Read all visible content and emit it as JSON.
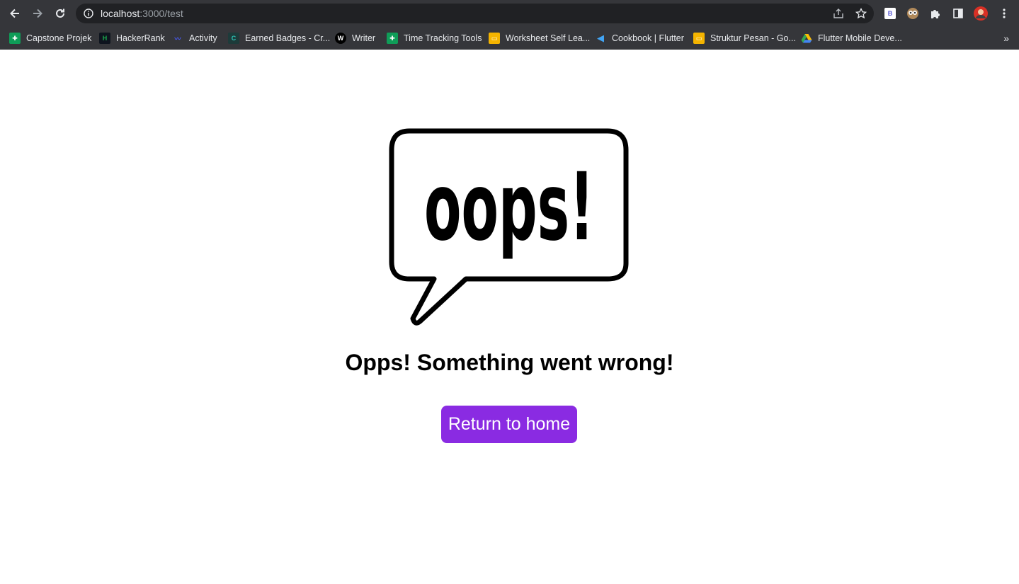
{
  "browser": {
    "url_host": "localhost",
    "url_rest": ":3000/test",
    "bookmarks": [
      {
        "label": "Capstone Projek",
        "icon": "sheets-icon",
        "color": "#0f9d58"
      },
      {
        "label": "HackerRank",
        "icon": "hackerrank-icon",
        "color": "#1ba94c"
      },
      {
        "label": "Activity",
        "icon": "activity-icon",
        "color": "#4a5cff"
      },
      {
        "label": "Earned Badges - Cr...",
        "icon": "credly-icon",
        "color": "#1a8a86"
      },
      {
        "label": "Writer",
        "icon": "writer-icon",
        "color": "#000000"
      },
      {
        "label": "Time Tracking Tools",
        "icon": "sheets-icon",
        "color": "#0f9d58"
      },
      {
        "label": "Worksheet Self Lea...",
        "icon": "slides-icon",
        "color": "#f4b400"
      },
      {
        "label": "Cookbook | Flutter",
        "icon": "flutter-icon",
        "color": "#42a5f5"
      },
      {
        "label": "Struktur Pesan - Go...",
        "icon": "slides-icon",
        "color": "#f4b400"
      },
      {
        "label": "Flutter Mobile Deve...",
        "icon": "drive-icon",
        "color": "#34a853"
      }
    ]
  },
  "page": {
    "illustration_text": "oops!",
    "heading": "Opps! Something went wrong!",
    "button_label": "Return to home",
    "accent_color": "#8a2be2"
  }
}
